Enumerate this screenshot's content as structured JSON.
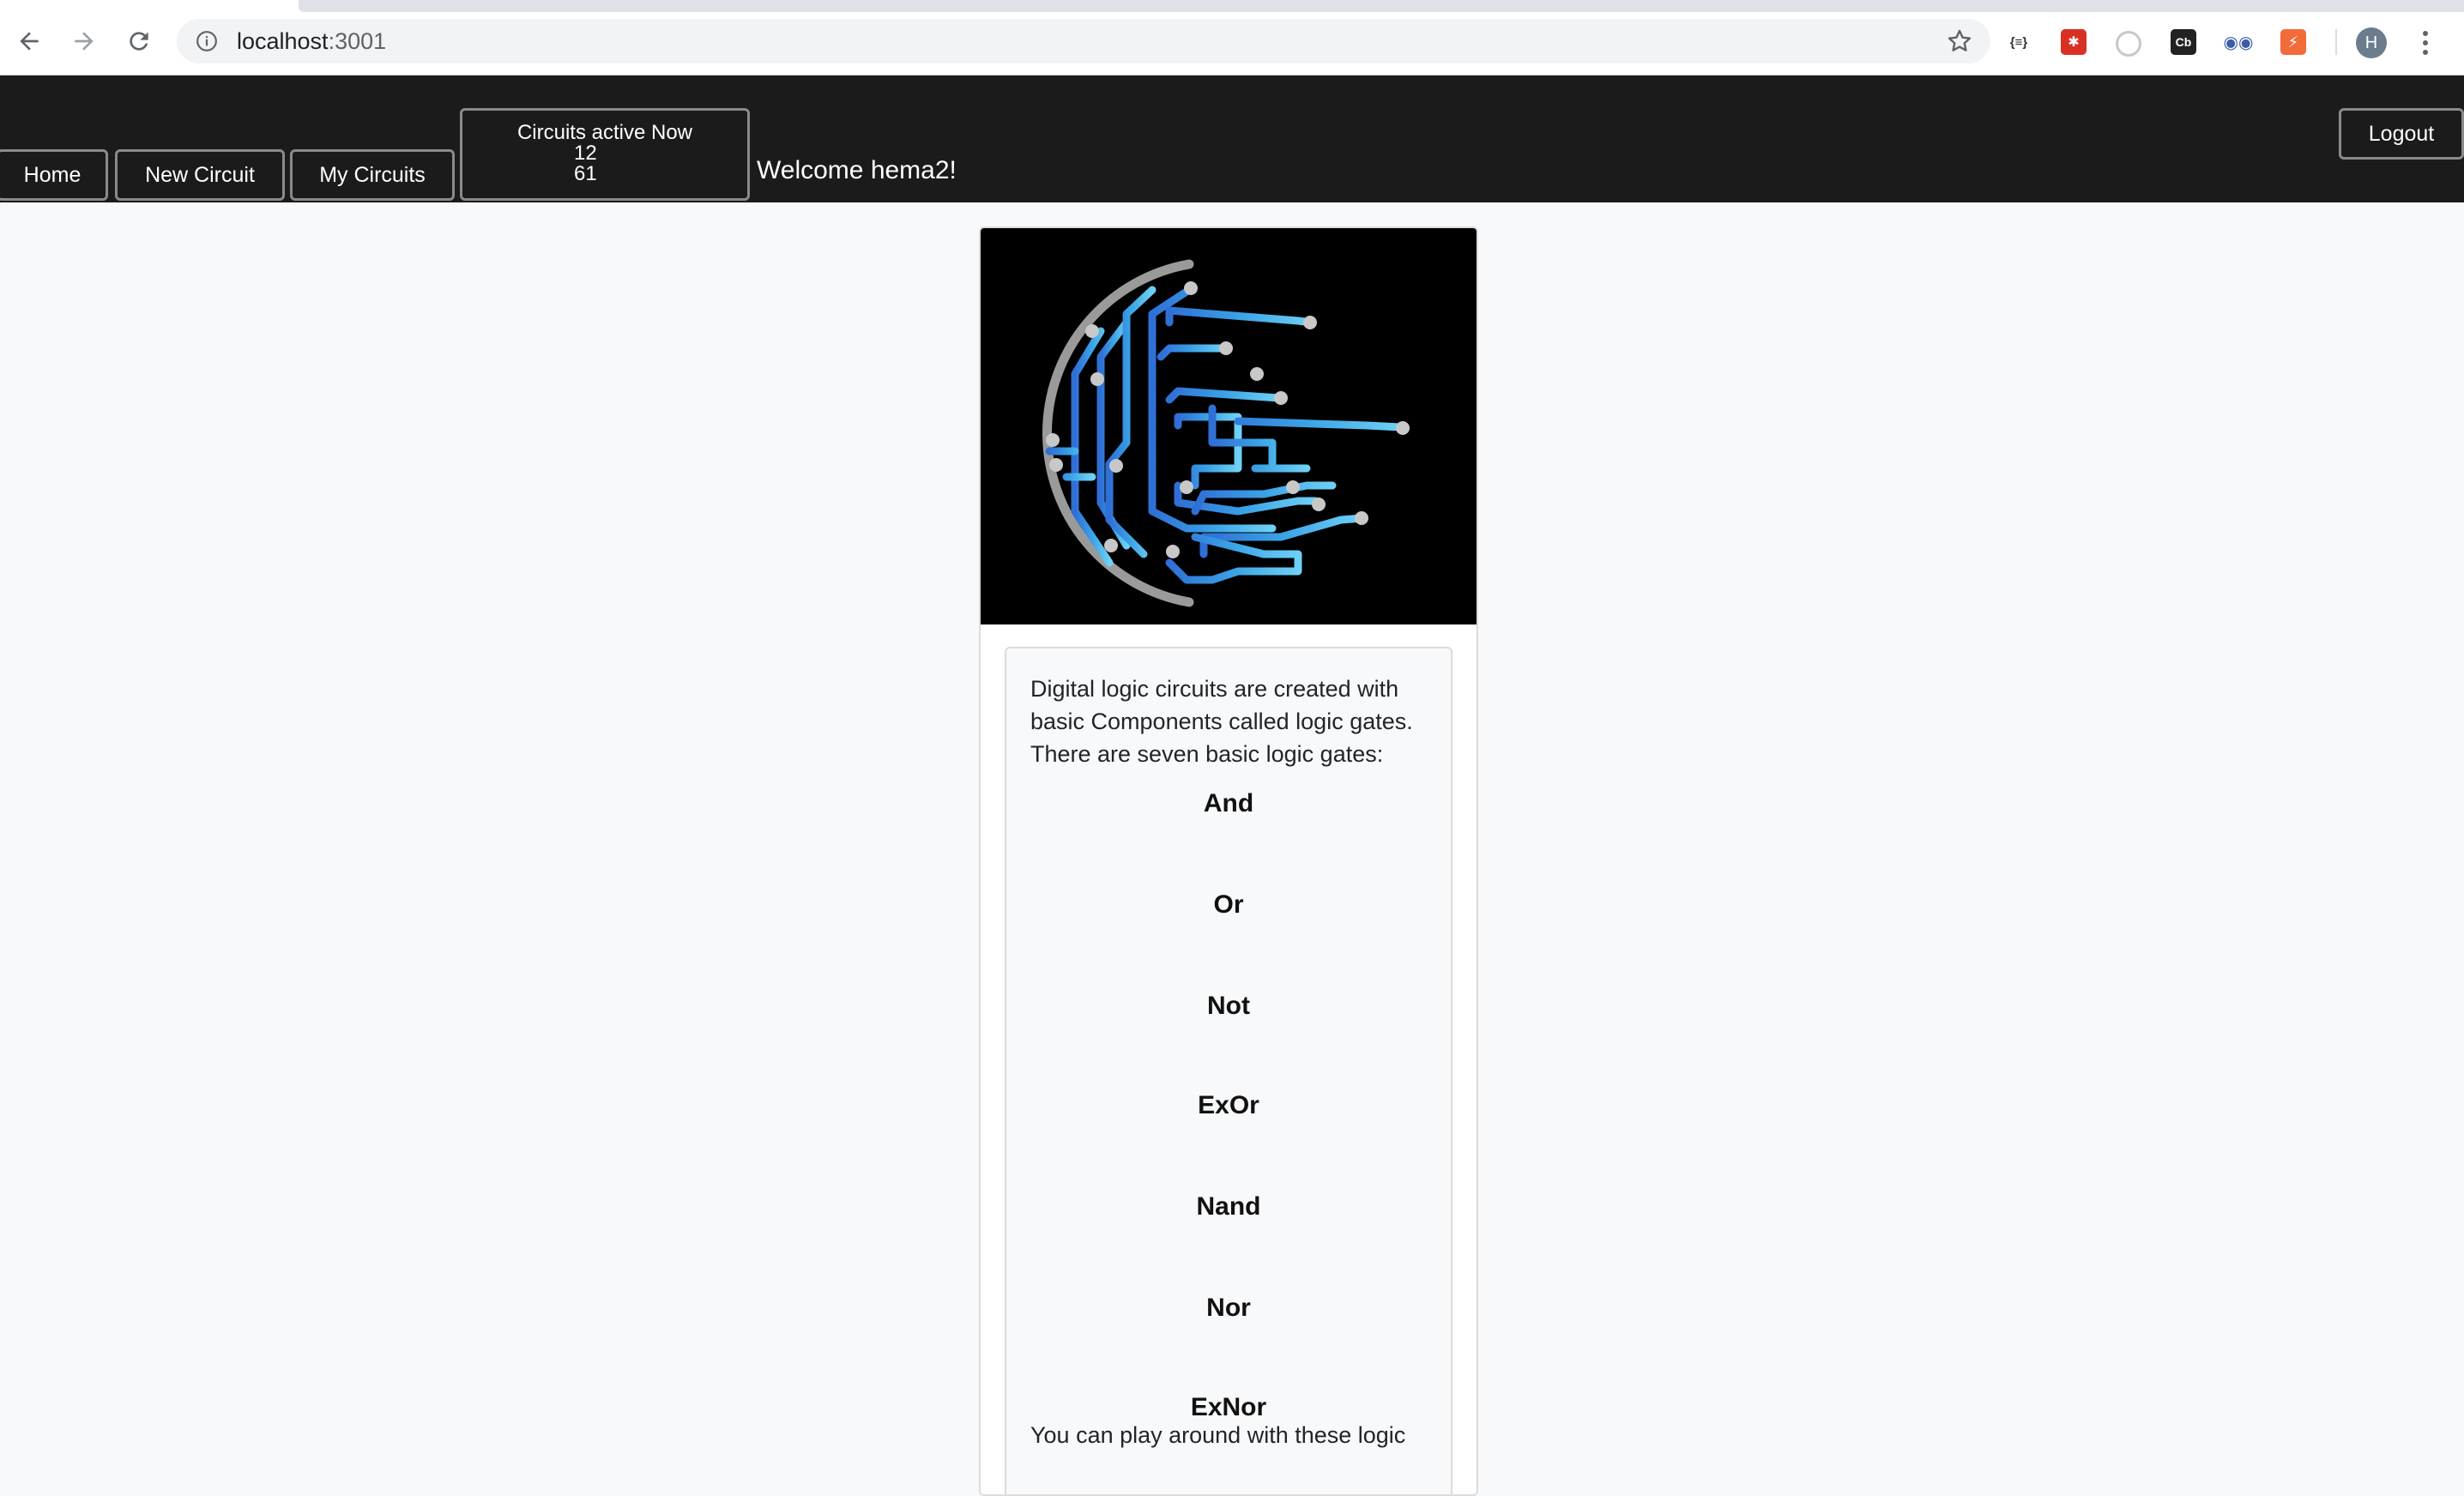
{
  "browser": {
    "url_host": "localhost",
    "url_port": ":3001",
    "extensions": [
      {
        "name": "json-viewer",
        "label": "{≡}"
      },
      {
        "name": "red-extension",
        "label": ""
      },
      {
        "name": "circle-extension",
        "label": ""
      },
      {
        "name": "cb-extension",
        "label": "Cb"
      },
      {
        "name": "eyes-extension",
        "label": ""
      },
      {
        "name": "orange-extension",
        "label": ""
      }
    ],
    "profile_initial": "H"
  },
  "navbar": {
    "home": "Home",
    "new_circuit": "New Circuit",
    "my_circuits": "My Circuits",
    "counter_title": "Circuits active Now",
    "counter_value_1": "12",
    "counter_value_2": "61",
    "welcome": "Welcome hema2!",
    "logout": "Logout"
  },
  "content": {
    "intro": "Digital logic circuits are created with basic Components called logic gates. There are seven basic logic gates:",
    "gates": [
      "And",
      "Or",
      "Not",
      "ExOr",
      "Nand",
      "Nor",
      "ExNor"
    ],
    "outro": "You can play around with these logic"
  }
}
